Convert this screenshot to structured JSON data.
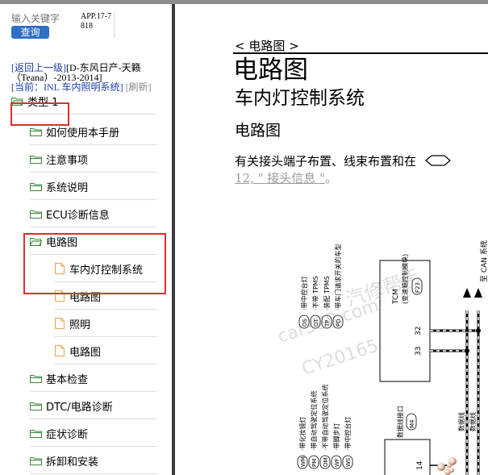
{
  "search": {
    "placeholder": "输入关键字",
    "button_label": "查询"
  },
  "app_code": "APP.17-7818",
  "breadcrumb": {
    "back_link": "[返回上一级]",
    "parent_title": "[D-东风日产-天籁（Teana）-2013-2014]",
    "current_prefix": "[当前：",
    "current_link": "INL 车内照明系统",
    "current_suffix": "]",
    "refresh": "[刷新]"
  },
  "tree": [
    {
      "label": "类型 1",
      "icon": "folder-open-icon"
    },
    {
      "label": "如何使用本手册",
      "icon": "folder-icon"
    },
    {
      "label": "注意事项",
      "icon": "folder-icon"
    },
    {
      "label": "系统说明",
      "icon": "folder-icon"
    },
    {
      "label": "ECU诊断信息",
      "icon": "folder-icon"
    },
    {
      "label": "电路图",
      "icon": "folder-open-icon"
    },
    {
      "label": "车内灯控制系统",
      "icon": "page-icon"
    },
    {
      "label": "电路图",
      "icon": "page-icon"
    },
    {
      "label": "照明",
      "icon": "page-icon"
    },
    {
      "label": "电路图",
      "icon": "page-icon"
    },
    {
      "label": "基本检查",
      "icon": "folder-icon"
    },
    {
      "label": "DTC/电路诊断",
      "icon": "folder-icon"
    },
    {
      "label": "症状诊断",
      "icon": "folder-icon"
    },
    {
      "label": "拆卸和安装",
      "icon": "folder-icon"
    }
  ],
  "colors": {
    "highlight": "#d93030",
    "accent": "#2f6fc4",
    "link": "#1a3fa8",
    "connector_fill": "#4aa84a"
  },
  "document": {
    "breadcrumb": "< 电路图 >",
    "title": "电路图",
    "subtitle": "车内灯控制系统",
    "section": "电路图",
    "paragraph": "有关接头端子布置、线束布置和在",
    "link_text": "12, \" 接头信息 \"",
    "link_suffix": "。",
    "diagram": {
      "legend_top": [
        {
          "code": "OS",
          "text": "带中控台灯"
        },
        {
          "code": "OT",
          "text": "不带 TPMS"
        },
        {
          "code": "TP",
          "text": "装配 TPMS"
        },
        {
          "code": "PD",
          "text": "带车门请求开关的车型"
        }
      ],
      "legend_bottom": [
        {
          "code": "WM",
          "text": "带化妆镜灯"
        },
        {
          "code": "PM",
          "text": "带自动驾驶定位系统"
        },
        {
          "code": "OM",
          "text": "不带自动驾驶定位系统"
        },
        {
          "code": "WF",
          "text": "带脚步灯"
        },
        {
          "code": "WS",
          "text": "带中控台灯"
        }
      ],
      "tcm_label": "TCM",
      "tcm_sub": "(变速箱控制模块)",
      "tcm_connector": "F23",
      "pin_32": "32",
      "pin_33": "33",
      "dlc_label": "数据线接口",
      "dlc_connector": "M4",
      "pin_14": "14",
      "can_label": "至 CAN 系统",
      "data_line_1": "数据线",
      "data_line_2": "数据线",
      "watermark_1": "汽修帮手",
      "watermark_2": "car388.com",
      "watermark_3": "CY20165"
    }
  }
}
